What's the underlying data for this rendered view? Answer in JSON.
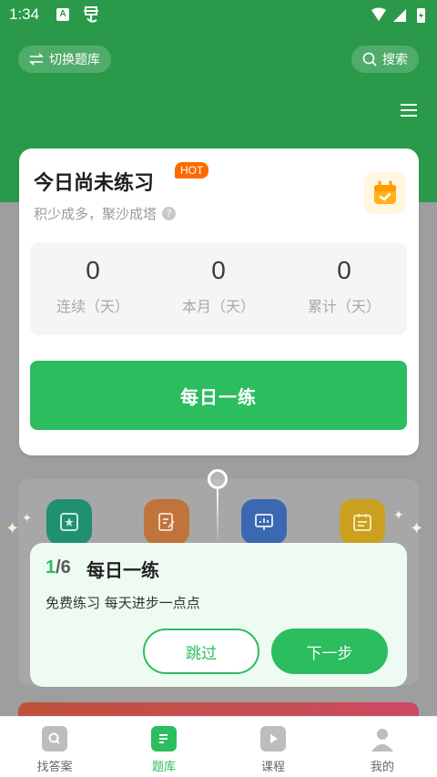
{
  "status_bar": {
    "time": "1:34",
    "app_badge": "A"
  },
  "header": {
    "switch_label": "切换题库",
    "search_label": "搜索"
  },
  "practice": {
    "title": "今日尚未练习",
    "hot_badge": "HOT",
    "subtitle": "积少成多，聚沙成塔",
    "stats": [
      {
        "value": "0",
        "label": "连续（天）"
      },
      {
        "value": "0",
        "label": "本月（天）"
      },
      {
        "value": "0",
        "label": "累计（天）"
      }
    ],
    "cta_label": "每日一练"
  },
  "guide": {
    "step": "1",
    "total": "/6",
    "title": "每日一练",
    "description": "免费练习 每天进步一点点",
    "skip_label": "跳过",
    "next_label": "下一步"
  },
  "tabs": [
    {
      "label": "找答案",
      "icon": "search-book-icon"
    },
    {
      "label": "题库",
      "icon": "question-bank-icon"
    },
    {
      "label": "课程",
      "icon": "play-icon"
    },
    {
      "label": "我的",
      "icon": "user-icon"
    }
  ],
  "colors": {
    "brand_green": "#2bbd5e",
    "header_green": "#2a9a4a",
    "hot_orange": "#ff6a00"
  }
}
